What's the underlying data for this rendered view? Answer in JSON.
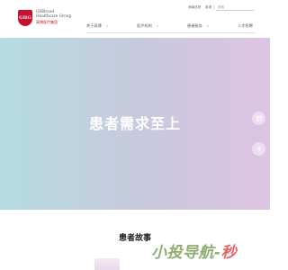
{
  "brand": {
    "mark": "GHG",
    "name_line1": "GHBroad",
    "name_line2": "Healthcare Group",
    "name_cn": "高博医疗集团"
  },
  "utility": {
    "link_label": "海南总院",
    "language": "英语",
    "search_placeholder": "搜索"
  },
  "nav": {
    "items": [
      {
        "label": "关于高博"
      },
      {
        "label": "医疗机构"
      },
      {
        "label": "患者服务"
      },
      {
        "label": "人才招聘"
      }
    ]
  },
  "hero": {
    "title": "患者需求至上"
  },
  "side_tools": {
    "chat_icon": "chat-bubble-icon",
    "top_icon": "arrow-up-icon"
  },
  "section": {
    "title": "患者故事"
  },
  "watermark": {
    "prefix": "小投导航-",
    "suffix": "秒"
  },
  "colors": {
    "brand_red": "#c8102e",
    "hero_left": "#b4dce1",
    "hero_right": "#ddc4e3"
  }
}
